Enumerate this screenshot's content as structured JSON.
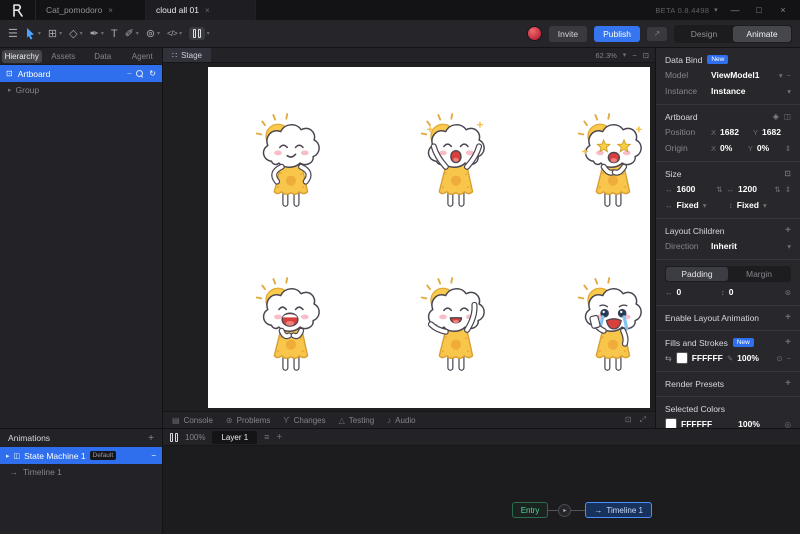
{
  "window": {
    "doc_tabs": [
      {
        "label": "Cat_pomodoro"
      },
      {
        "label": "cloud all 01"
      }
    ],
    "beta_label": "BETA 0.8.4498",
    "minimize": "—",
    "maximize": "□",
    "close": "×"
  },
  "toolbar": {
    "invite_label": "Invite",
    "publish_label": "Publish",
    "mode_tabs": [
      {
        "label": "Design"
      },
      {
        "label": "Animate"
      }
    ]
  },
  "left_panel": {
    "tabs": [
      "Hierarchy",
      "Assets",
      "Data",
      "Agent"
    ],
    "artboard_label": "Artboard",
    "group_label": "Group"
  },
  "animations_panel": {
    "title": "Animations",
    "state_machine_label": "State Machine 1",
    "state_machine_badge": "Default",
    "timeline_label": "Timeline 1"
  },
  "stage": {
    "tab_label": "Stage",
    "zoom_level": "62.3%"
  },
  "canvas": {
    "characters": [
      {
        "name": "cloud-hands-on-hips",
        "emotion": "smug"
      },
      {
        "name": "cloud-jumping-joy",
        "emotion": "joy"
      },
      {
        "name": "cloud-starstruck",
        "emotion": "starstruck"
      },
      {
        "name": "cloud-laughing",
        "emotion": "laugh"
      },
      {
        "name": "cloud-waving",
        "emotion": "wave"
      },
      {
        "name": "cloud-crying",
        "emotion": "cry"
      }
    ]
  },
  "console_bar": {
    "tabs": [
      "Console",
      "Problems",
      "Changes",
      "Testing",
      "Audio"
    ]
  },
  "timeline_bar": {
    "zoom": "100%",
    "layer_label": "Layer 1"
  },
  "state_machine_graph": {
    "entry_label": "Entry",
    "timeline_node_label": "Timeline 1"
  },
  "inspector": {
    "data_bind": {
      "title": "Data Bind",
      "badge": "New",
      "model_label": "Model",
      "model_value": "ViewModel1",
      "instance_label": "Instance",
      "instance_value": "Instance"
    },
    "artboard": {
      "title": "Artboard",
      "position_label": "Position",
      "pos_x": "1682",
      "pos_y": "1682",
      "origin_label": "Origin",
      "origin_x": "0%",
      "origin_y": "0%"
    },
    "size": {
      "title": "Size",
      "width": "1600",
      "height": "1200",
      "width_mode": "Fixed",
      "height_mode": "Fixed"
    },
    "layout_children": {
      "title": "Layout Children",
      "direction_label": "Direction",
      "direction_value": "Inherit"
    },
    "spacing": {
      "padding_tab": "Padding",
      "margin_tab": "Margin",
      "pad_a": "0",
      "pad_b": "0"
    },
    "layout_animation": {
      "title": "Enable Layout Animation"
    },
    "fills": {
      "title": "Fills and Strokes",
      "badge": "New",
      "hex": "FFFFFF",
      "opacity": "100%"
    },
    "render_presets": {
      "title": "Render Presets"
    },
    "selected_colors": {
      "title": "Selected Colors",
      "hex": "FFFFFF",
      "opacity": "100%"
    }
  },
  "colors": {
    "selection_blue": "#2f6fed",
    "publish_blue": "#3575f0",
    "entry_green": "#57d79a",
    "node_border_blue": "#4c8dff",
    "fill_hex": "#FFFFFF",
    "dress_yellow": "#f8c64a",
    "sun_yellow": "#f9ca4b"
  }
}
